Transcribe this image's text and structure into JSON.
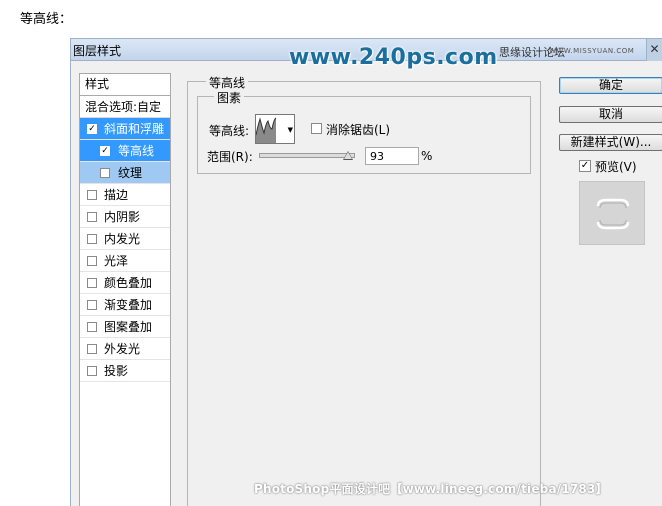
{
  "caption": "等高线：",
  "dialog": {
    "title": "图层样式",
    "site_text": "www.240ps.com",
    "forum_text": "思缘设计论坛",
    "forum_url": "WWW.MISSYUAN.COM"
  },
  "style_list": {
    "header": "样式",
    "blend_options": "混合选项:自定",
    "items": [
      {
        "label": "斜面和浮雕",
        "checked": true,
        "selected": true
      },
      {
        "label": "等高线",
        "checked": true,
        "selected": true,
        "sub": true
      },
      {
        "label": "纹理",
        "checked": false,
        "sub": true
      },
      {
        "label": "描边",
        "checked": false
      },
      {
        "label": "内阴影",
        "checked": false
      },
      {
        "label": "内发光",
        "checked": false
      },
      {
        "label": "光泽",
        "checked": false
      },
      {
        "label": "颜色叠加",
        "checked": false
      },
      {
        "label": "渐变叠加",
        "checked": false
      },
      {
        "label": "图案叠加",
        "checked": false
      },
      {
        "label": "外发光",
        "checked": false
      },
      {
        "label": "投影",
        "checked": false
      }
    ]
  },
  "contour_panel": {
    "group_title": "等高线",
    "subgroup_title": "图素",
    "contour_label": "等高线:",
    "anti_alias_label": "消除锯齿(L)",
    "anti_alias_checked": false,
    "range_label": "范围(R):",
    "range_value": "93",
    "range_fraction": 0.93,
    "range_unit": "%"
  },
  "buttons": {
    "ok": "确定",
    "cancel": "取消",
    "new_style": "新建样式(W)...",
    "preview_label": "预览(V)",
    "preview_checked": true
  },
  "watermark": "PhotoShop平面设计吧【www.lineeg.com/tieba/1783】",
  "colors": {
    "selection": "#3399ff",
    "sub_selection": "#9fc8f2",
    "site_blue": "#1a6f9e"
  }
}
